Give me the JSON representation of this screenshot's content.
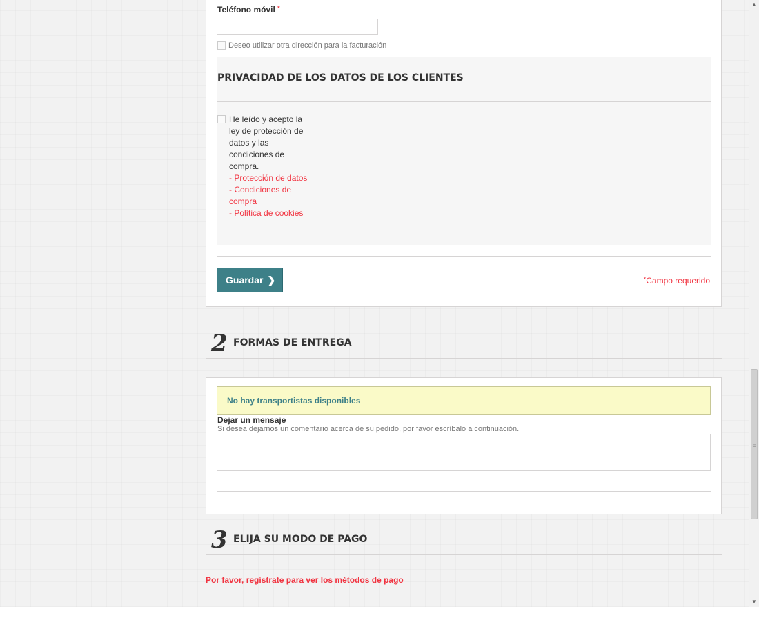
{
  "address_form": {
    "mobile_label": "Teléfono móvil",
    "required_mark": "*",
    "billing_checkbox_label": "Deseo utilizar otra dirección para la facturación"
  },
  "privacy": {
    "title": "PRIVACIDAD DE LOS DATOS DE LOS CLIENTES",
    "accept_text": "He leído y acepto la ley de protección de datos y las condiciones de compra.",
    "links": [
      "- Protección de datos",
      "- Condiciones de compra",
      "- Política de cookies"
    ]
  },
  "actions": {
    "save_label": "Guardar",
    "save_icon": "chevron-right-icon",
    "required_note_mark": "*",
    "required_note": "Campo requerido"
  },
  "step2": {
    "number": "2",
    "title": "FORMAS DE ENTREGA",
    "alert": "No hay transportistas disponibles",
    "message_label": "Dejar un mensaje",
    "message_help": "Si desea dejarnos un comentario acerca de su pedido, por favor escríbalo a continuación."
  },
  "step3": {
    "number": "3",
    "title": "ELIJA SU MODO DE PAGO",
    "warning": "Por favor, regístrate para ver los métodos de pago"
  },
  "colors": {
    "accent": "#3d8088",
    "error": "#f13340",
    "alert_bg": "#fafac8"
  }
}
